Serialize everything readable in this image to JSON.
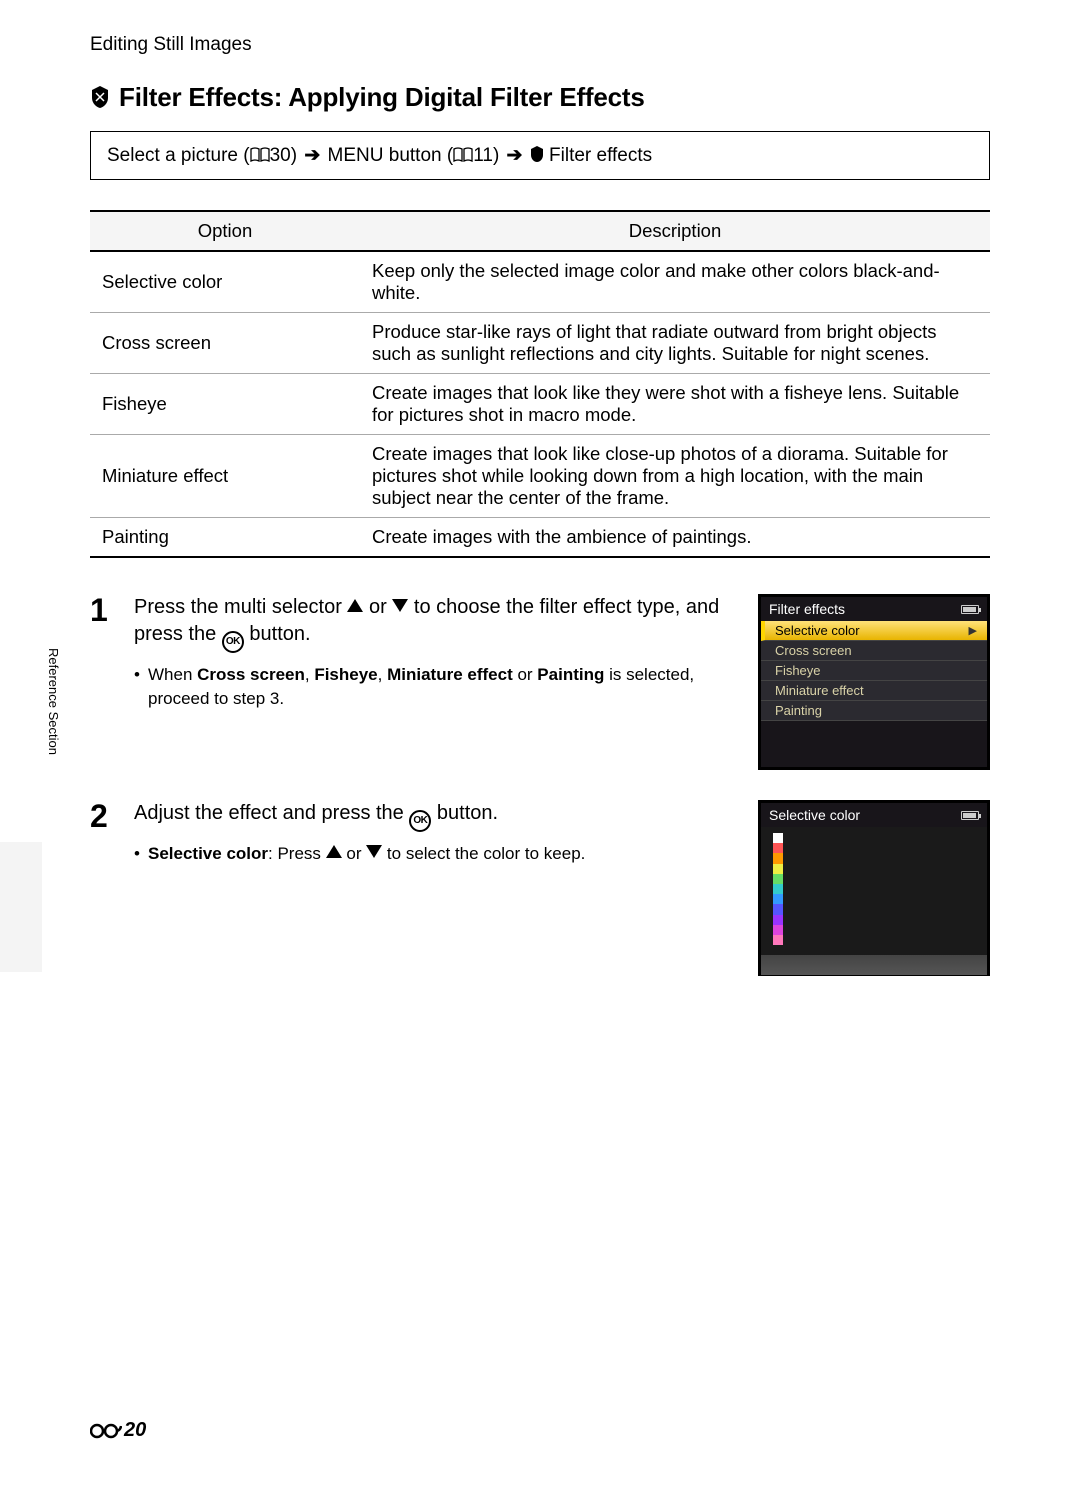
{
  "breadcrumb": "Editing Still Images",
  "heading": "Filter Effects: Applying Digital Filter Effects",
  "nav": {
    "prefix": "Select a picture (",
    "ref1": "30",
    "mid1": ") ",
    "menu_label": "MENU",
    "mid2": " button (",
    "ref2": "11",
    "mid3": ") ",
    "suffix": " Filter effects"
  },
  "table": {
    "h1": "Option",
    "h2": "Description",
    "rows": [
      {
        "opt": "Selective color",
        "desc": "Keep only the selected image color and make other colors black-and-white."
      },
      {
        "opt": "Cross screen",
        "desc": "Produce star-like rays of light that radiate outward from bright objects such as sunlight reflections and city lights. Suitable for night scenes."
      },
      {
        "opt": "Fisheye",
        "desc": "Create images that look like they were shot with a fisheye lens. Suitable for pictures shot in macro mode."
      },
      {
        "opt": "Miniature effect",
        "desc": "Create images that look like close-up photos of a diorama. Suitable for pictures shot while looking down from a high location, with the main subject near the center of the frame."
      },
      {
        "opt": "Painting",
        "desc": "Create images with the ambience of paintings."
      }
    ]
  },
  "step1": {
    "num": "1",
    "title_a": "Press the multi selector ",
    "title_b": " or ",
    "title_c": " to choose the filter effect type, and press the ",
    "title_d": " button.",
    "bullet_a": "When ",
    "b1": "Cross screen",
    "sep1": ", ",
    "b2": "Fisheye",
    "sep2": ", ",
    "b3": "Miniature effect",
    "sep3": " or ",
    "b4": "Painting",
    "bullet_b": " is selected, proceed to step 3."
  },
  "lcd1": {
    "title": "Filter effects",
    "items": [
      "Selective color",
      "Cross screen",
      "Fisheye",
      "Miniature effect",
      "Painting"
    ]
  },
  "step2": {
    "num": "2",
    "title_a": "Adjust the effect and press the ",
    "title_b": " button.",
    "bullet_label": "Selective color",
    "bullet_a": ": Press ",
    "bullet_b": " or ",
    "bullet_c": " to select the color to keep."
  },
  "lcd2": {
    "title": "Selective color"
  },
  "side_tab": "Reference Section",
  "page_num": "20"
}
